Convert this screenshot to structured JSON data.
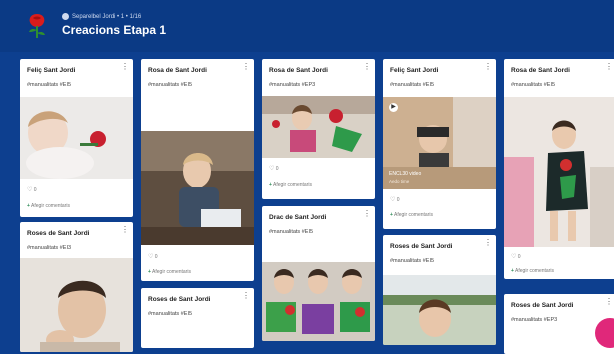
{
  "header": {
    "meta": "Separelbel Jordi • 1 • 1/16",
    "title": "Creacions Etapa 1"
  },
  "cards": [
    {
      "title": "Feliç Sant Jordi",
      "tag": "#manualitats #EI5",
      "likes": "0",
      "comment": "Afegir comentaris"
    },
    {
      "title": "Rosa de Sant Jordi",
      "tag": "#manualitats #EI5",
      "likes": "0",
      "comment": "Afegir comentaris"
    },
    {
      "title": "Rosa de Sant Jordi",
      "tag": "#manualitats #EP3",
      "likes": "0",
      "comment": "Afegir comentaris"
    },
    {
      "title": "Feliç Sant Jordi",
      "tag": "#manualitats #EI5",
      "likes": "0",
      "comment": "Afegir comentaris",
      "video_title": "ENCL30 video",
      "video_sub": "Aedo time"
    },
    {
      "title": "Rosa de Sant Jordi",
      "tag": "#manualitats #EI5",
      "likes": "0",
      "comment": "Afegir comentaris"
    },
    {
      "title": "Roses de Sant Jordi",
      "tag": "#manualitats #EI3"
    },
    {
      "title": "Roses de Sant Jordi",
      "tag": "#manualitats #EI5"
    },
    {
      "title": "Drac de Sant Jordi",
      "tag": "#manualitats #EI5"
    },
    {
      "title": "Roses de Sant Jordi",
      "tag": "#manualitats #EI5"
    },
    {
      "title": "Roses de Sant Jordi",
      "tag": "#manualitats #EP3"
    }
  ],
  "colors": {
    "header": "#0b3a85",
    "background": "#0d3f8f",
    "accent": "#e0287a"
  }
}
